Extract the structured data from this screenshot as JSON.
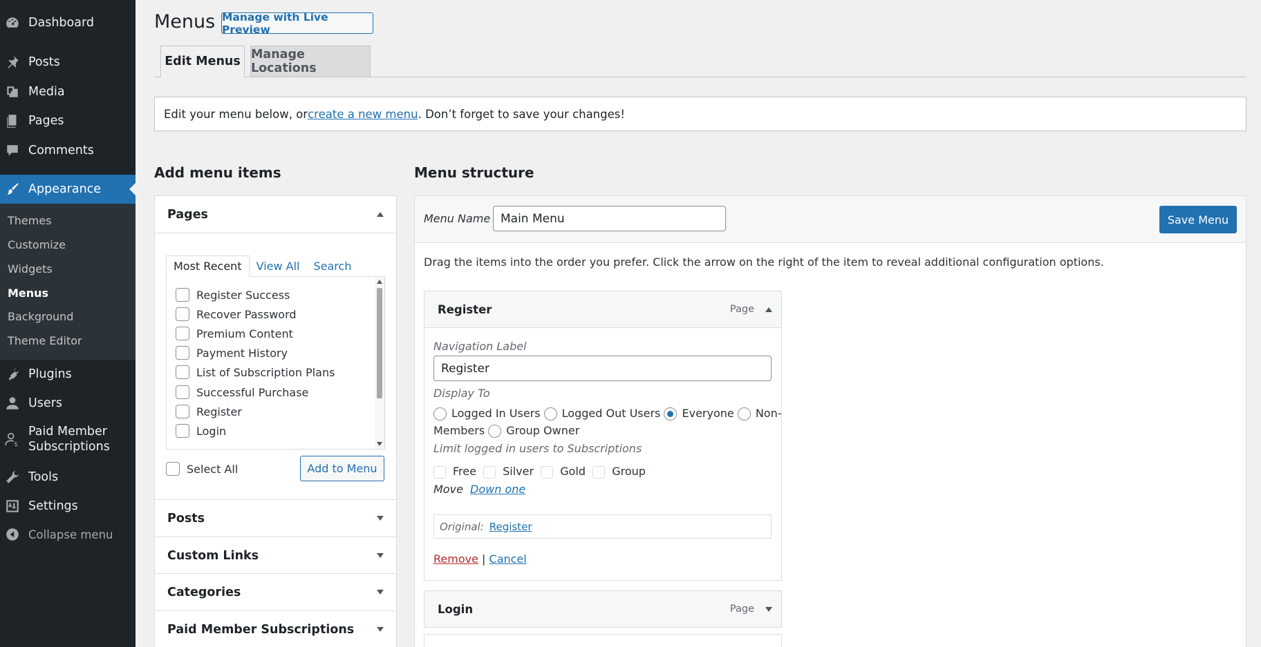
{
  "sidebar": {
    "items": [
      {
        "label": "Dashboard",
        "icon": "dashboard-icon"
      },
      {
        "label": "Posts",
        "icon": "pin-icon"
      },
      {
        "label": "Media",
        "icon": "media-icon"
      },
      {
        "label": "Pages",
        "icon": "pages-icon"
      },
      {
        "label": "Comments",
        "icon": "comment-icon"
      },
      {
        "label": "Appearance",
        "icon": "brush-icon"
      },
      {
        "label": "Plugins",
        "icon": "plugin-icon"
      },
      {
        "label": "Users",
        "icon": "user-icon"
      },
      {
        "label": "Paid Member Subscriptions",
        "label_line1": "Paid Member",
        "label_line2": "Subscriptions",
        "icon": "member-icon"
      },
      {
        "label": "Tools",
        "icon": "wrench-icon"
      },
      {
        "label": "Settings",
        "icon": "settings-icon"
      },
      {
        "label": "Collapse menu",
        "icon": "collapse-icon"
      }
    ],
    "submenu": [
      "Themes",
      "Customize",
      "Widgets",
      "Menus",
      "Background",
      "Theme Editor"
    ],
    "active_submenu": "Menus"
  },
  "header": {
    "title": "Menus",
    "live_preview_button": "Manage with Live Preview"
  },
  "tabs": [
    {
      "label": "Edit Menus",
      "active": true
    },
    {
      "label": "Manage Locations",
      "active": false
    }
  ],
  "notice": {
    "before": "Edit your menu below, or ",
    "link": "create a new menu",
    "after": ". Don’t forget to save your changes!"
  },
  "add_items": {
    "heading": "Add menu items",
    "pages_panel": {
      "title": "Pages",
      "tabs": [
        "Most Recent",
        "View All",
        "Search"
      ],
      "pages": [
        "Register Success",
        "Recover Password",
        "Premium Content",
        "Payment History",
        "List of Subscription Plans",
        "Successful Purchase",
        "Register",
        "Login"
      ],
      "select_all": "Select All",
      "add_button": "Add to Menu"
    },
    "other_panels": [
      "Posts",
      "Custom Links",
      "Categories",
      "Paid Member Subscriptions"
    ]
  },
  "structure": {
    "heading": "Menu structure",
    "menu_name_label": "Menu Name",
    "menu_name_value": "Main Menu",
    "save_button": "Save Menu",
    "hint": "Drag the items into the order you prefer. Click the arrow on the right of the item to reveal additional configuration options.",
    "items": [
      {
        "title": "Register",
        "type": "Page",
        "expanded": true,
        "nav_label_caption": "Navigation Label",
        "nav_label_value": "Register",
        "display_to_caption": "Display To",
        "display_options": [
          "Logged In Users",
          "Logged Out Users",
          "Everyone",
          "Non-"
        ],
        "display_options_line2_prefix": "Members",
        "display_options_line2": [
          "Group Owner"
        ],
        "selected": "Everyone",
        "limit_caption": "Limit logged in users to Subscriptions",
        "subscriptions": [
          "Free",
          "Silver",
          "Gold",
          "Group"
        ],
        "move_caption": "Move",
        "move_link": "Down one",
        "original_caption": "Original:",
        "original_link": "Register",
        "remove": "Remove",
        "separator": "|",
        "cancel": "Cancel"
      },
      {
        "title": "Login",
        "type": "Page",
        "expanded": false
      }
    ]
  },
  "colors": {
    "accent": "#2271b1",
    "sidebar_bg": "#1d2327",
    "danger": "#b32d2e"
  }
}
